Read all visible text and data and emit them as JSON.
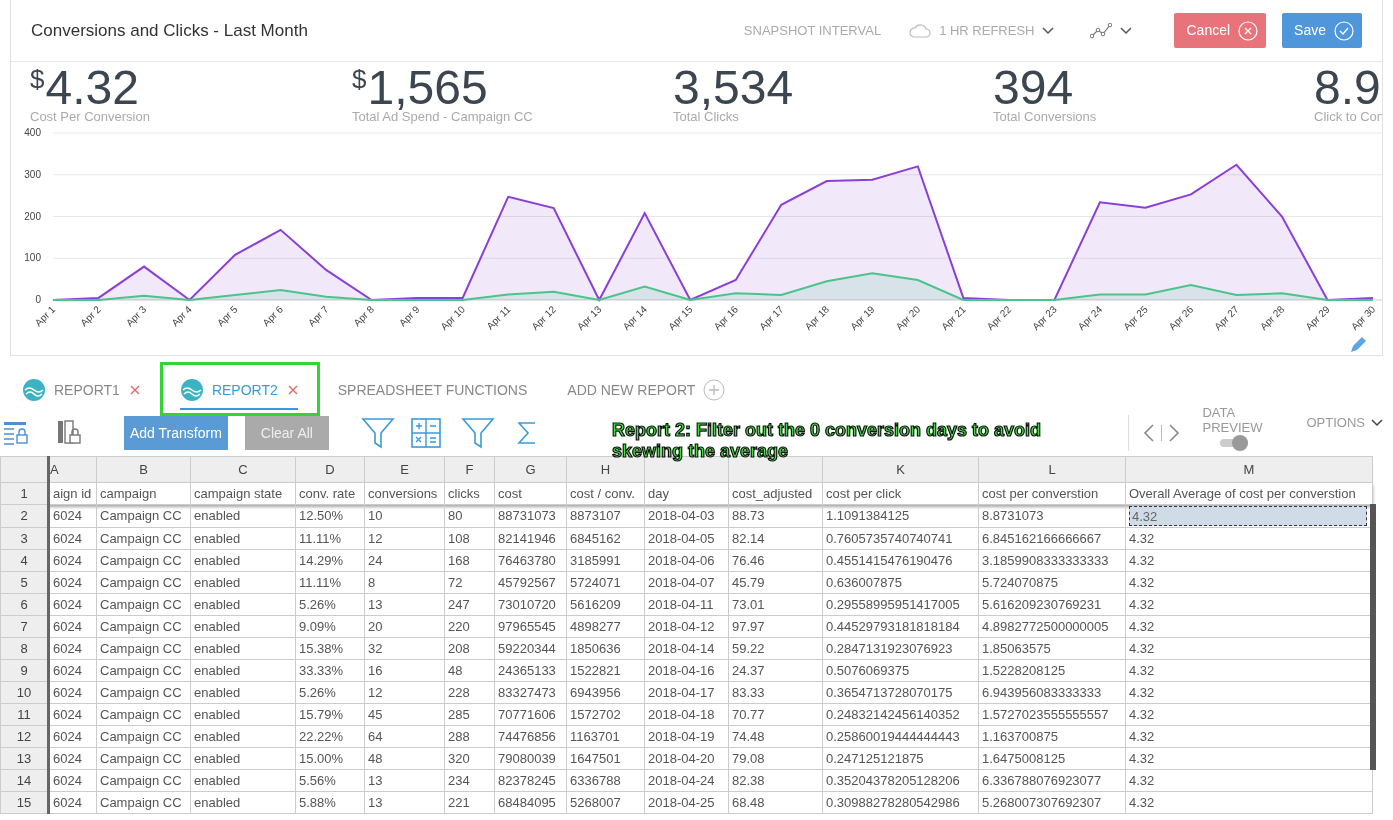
{
  "header": {
    "title": "Conversions and Clicks - Last Month",
    "interval_label": "SNAPSHOT INTERVAL",
    "refresh": "1 HR REFRESH",
    "buttons": [
      {
        "kind": "cancel",
        "label": "Cancel"
      },
      {
        "kind": "save",
        "label": "Save"
      }
    ]
  },
  "kpis": [
    {
      "currency": "$",
      "value": "4.32",
      "label": "Cost Per Conversion"
    },
    {
      "currency": "$",
      "value": "1,565",
      "label": "Total Ad Spend - Campaign CC"
    },
    {
      "value": "3,534",
      "label": "Total Clicks"
    },
    {
      "value": "394",
      "label": "Total Conversions"
    },
    {
      "value": "8.9",
      "label": "Click to Con"
    }
  ],
  "chart_data": {
    "type": "area",
    "categories": [
      "Apr 1",
      "Apr 2",
      "Apr 3",
      "Apr 4",
      "Apr 5",
      "Apr 6",
      "Apr 7",
      "Apr 8",
      "Apr 9",
      "Apr 10",
      "Apr 11",
      "Apr 12",
      "Apr 13",
      "Apr 14",
      "Apr 15",
      "Apr 16",
      "Apr 17",
      "Apr 18",
      "Apr 19",
      "Apr 20",
      "Apr 21",
      "Apr 22",
      "Apr 23",
      "Apr 24",
      "Apr 25",
      "Apr 26",
      "Apr 27",
      "Apr 28",
      "Apr 29",
      "Apr 30"
    ],
    "ylim": [
      0,
      400
    ],
    "grid": true,
    "yticks": [
      0,
      100,
      200,
      300,
      400
    ],
    "series": [
      {
        "color": "#8a3fd8",
        "values": [
          0,
          5,
          80,
          0,
          108,
          168,
          72,
          0,
          5,
          5,
          247,
          220,
          0,
          208,
          0,
          48,
          228,
          285,
          288,
          320,
          5,
          0,
          0,
          234,
          221,
          253,
          324,
          200,
          0,
          5
        ]
      },
      {
        "color": "#4cc38a",
        "values": [
          0,
          0,
          10,
          0,
          12,
          24,
          8,
          0,
          0,
          0,
          13,
          20,
          0,
          32,
          0,
          16,
          12,
          45,
          64,
          48,
          0,
          0,
          0,
          13,
          13,
          36,
          12,
          16,
          0,
          0
        ]
      }
    ]
  },
  "tabs": [
    {
      "kind": "report",
      "label": "REPORT1",
      "selected": false
    },
    {
      "kind": "report",
      "label": "REPORT2",
      "selected": true
    },
    {
      "kind": "functions",
      "label": "SPREADSHEET FUNCTIONS",
      "selected": false
    },
    {
      "kind": "add",
      "label": "ADD NEW REPORT",
      "selected": false
    }
  ],
  "toolbar": {
    "add_button": "Add Transform",
    "clear_button": "Clear All",
    "clear_disabled": true,
    "preview_label": "DATA PREVIEW",
    "preview_on": true,
    "options": "OPTIONS"
  },
  "annotation": "Report 2: Filter out the 0 conversion days to avoid skewing the average",
  "table": {
    "columns": [
      {
        "letter": "A",
        "header": "aign id"
      },
      {
        "letter": "B",
        "header": "campaign"
      },
      {
        "letter": "C",
        "header": "campaign state"
      },
      {
        "letter": "D",
        "header": "conv. rate"
      },
      {
        "letter": "E",
        "header": "conversions"
      },
      {
        "letter": "F",
        "header": "clicks"
      },
      {
        "letter": "G",
        "header": "cost"
      },
      {
        "letter": "H",
        "header": "cost / conv."
      },
      {
        "header": "day"
      },
      {
        "header": "cost_adjusted"
      },
      {
        "letter": "K",
        "header": "cost per click"
      },
      {
        "letter": "L",
        "header": "cost per converstion"
      },
      {
        "letter": "M",
        "header": "Overall Average of cost per converstion"
      }
    ],
    "header_row": "1",
    "rows": [
      {
        "num": "2",
        "selected": true,
        "cells": [
          "6024",
          "Campaign CC",
          "enabled",
          "12.50%",
          "10",
          "80",
          "88731073",
          "8873107",
          "2018-04-03",
          "88.73",
          "1.1091384125",
          "8.8731073",
          "4.32"
        ]
      },
      {
        "num": "3",
        "selected": false,
        "cells": [
          "6024",
          "Campaign CC",
          "enabled",
          "11.11%",
          "12",
          "108",
          "82141946",
          "6845162",
          "2018-04-05",
          "82.14",
          "0.7605735740740741",
          "6.845162166666667",
          "4.32"
        ]
      },
      {
        "num": "4",
        "selected": false,
        "cells": [
          "6024",
          "Campaign CC",
          "enabled",
          "14.29%",
          "24",
          "168",
          "76463780",
          "3185991",
          "2018-04-06",
          "76.46",
          "0.4551415476190476",
          "3.1859908333333333",
          "4.32"
        ]
      },
      {
        "num": "5",
        "selected": false,
        "cells": [
          "6024",
          "Campaign CC",
          "enabled",
          "11.11%",
          "8",
          "72",
          "45792567",
          "5724071",
          "2018-04-07",
          "45.79",
          "0.636007875",
          "5.724070875",
          "4.32"
        ]
      },
      {
        "num": "6",
        "selected": false,
        "cells": [
          "6024",
          "Campaign CC",
          "enabled",
          "5.26%",
          "13",
          "247",
          "73010720",
          "5616209",
          "2018-04-11",
          "73.01",
          "0.29558995951417005",
          "5.616209230769231",
          "4.32"
        ]
      },
      {
        "num": "7",
        "selected": false,
        "cells": [
          "6024",
          "Campaign CC",
          "enabled",
          "9.09%",
          "20",
          "220",
          "97965545",
          "4898277",
          "2018-04-12",
          "97.97",
          "0.44529793181818184",
          "4.8982772500000005",
          "4.32"
        ]
      },
      {
        "num": "8",
        "selected": false,
        "cells": [
          "6024",
          "Campaign CC",
          "enabled",
          "15.38%",
          "32",
          "208",
          "59220344",
          "1850636",
          "2018-04-14",
          "59.22",
          "0.2847131923076923",
          "1.85063575",
          "4.32"
        ]
      },
      {
        "num": "9",
        "selected": false,
        "cells": [
          "6024",
          "Campaign CC",
          "enabled",
          "33.33%",
          "16",
          "48",
          "24365133",
          "1522821",
          "2018-04-16",
          "24.37",
          "0.5076069375",
          "1.5228208125",
          "4.32"
        ]
      },
      {
        "num": "10",
        "selected": false,
        "cells": [
          "6024",
          "Campaign CC",
          "enabled",
          "5.26%",
          "12",
          "228",
          "83327473",
          "6943956",
          "2018-04-17",
          "83.33",
          "0.3654713728070175",
          "6.943956083333333",
          "4.32"
        ]
      },
      {
        "num": "11",
        "selected": false,
        "cells": [
          "6024",
          "Campaign CC",
          "enabled",
          "15.79%",
          "45",
          "285",
          "70771606",
          "1572702",
          "2018-04-18",
          "70.77",
          "0.24832142456140352",
          "1.5727023555555557",
          "4.32"
        ]
      },
      {
        "num": "12",
        "selected": false,
        "cells": [
          "6024",
          "Campaign CC",
          "enabled",
          "22.22%",
          "64",
          "288",
          "74476856",
          "1163701",
          "2018-04-19",
          "74.48",
          "0.25860019444444443",
          "1.163700875",
          "4.32"
        ]
      },
      {
        "num": "13",
        "selected": false,
        "cells": [
          "6024",
          "Campaign CC",
          "enabled",
          "15.00%",
          "48",
          "320",
          "79080039",
          "1647501",
          "2018-04-20",
          "79.08",
          "0.247125121875",
          "1.6475008125",
          "4.32"
        ]
      },
      {
        "num": "14",
        "selected": false,
        "cells": [
          "6024",
          "Campaign CC",
          "enabled",
          "5.56%",
          "13",
          "234",
          "82378245",
          "6336788",
          "2018-04-24",
          "82.38",
          "0.35204378205128206",
          "6.336788076923077",
          "4.32"
        ]
      },
      {
        "num": "15",
        "selected": false,
        "cells": [
          "6024",
          "Campaign CC",
          "enabled",
          "5.88%",
          "13",
          "221",
          "68484095",
          "5268007",
          "2018-04-25",
          "68.48",
          "0.30988278280542986",
          "5.268007307692307",
          "4.32"
        ]
      }
    ]
  }
}
